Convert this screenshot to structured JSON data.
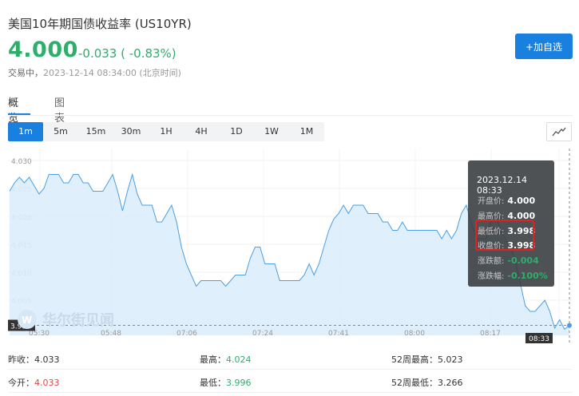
{
  "header": {
    "title": "美国10年期国债收益率 (US10YR)",
    "price": "4.000",
    "change": "-0.033 ( -0.83%)",
    "status_label": "交易中",
    "status_time": "2023-12-14 08:34:00 (北京时间)",
    "add_button": "+加自选"
  },
  "tabs": [
    {
      "label": "概览",
      "active": true
    },
    {
      "label": "图表",
      "active": false
    }
  ],
  "periods": [
    {
      "label": "1m",
      "active": true
    },
    {
      "label": "5m"
    },
    {
      "label": "15m"
    },
    {
      "label": "30m"
    },
    {
      "label": "1H"
    },
    {
      "label": "4H"
    },
    {
      "label": "1D"
    },
    {
      "label": "1W"
    },
    {
      "label": "1M"
    }
  ],
  "chart_data": {
    "type": "area",
    "y_ticks": [
      "4.030",
      "4.025",
      "4.020",
      "4.015",
      "4.010",
      "4.005",
      "4.000"
    ],
    "x_ticks": [
      "05:30",
      "05:48",
      "07:06",
      "07:24",
      "07:41",
      "08:00",
      "08:17",
      "08:33"
    ],
    "ylim": [
      3.999,
      4.031
    ],
    "current_label": "3.998",
    "time_label": "08:33",
    "values": [
      4.0245,
      4.026,
      4.027,
      4.026,
      4.027,
      4.0255,
      4.024,
      4.025,
      4.0275,
      4.0275,
      4.0275,
      4.026,
      4.026,
      4.0275,
      4.0275,
      4.026,
      4.026,
      4.0245,
      4.0245,
      4.0245,
      4.026,
      4.0275,
      4.0245,
      4.021,
      4.0245,
      4.0275,
      4.024,
      4.022,
      4.022,
      4.022,
      4.019,
      4.019,
      4.0205,
      4.022,
      4.019,
      4.0145,
      4.0115,
      4.0095,
      4.0075,
      4.0085,
      4.0085,
      4.0085,
      4.0085,
      4.0085,
      4.0075,
      4.0085,
      4.0095,
      4.0095,
      4.0095,
      4.0125,
      4.0145,
      4.0145,
      4.0115,
      4.0115,
      4.0115,
      4.0085,
      4.0085,
      4.0085,
      4.0085,
      4.0085,
      4.0095,
      4.0115,
      4.0095,
      4.0115,
      4.0145,
      4.0175,
      4.0195,
      4.0205,
      4.022,
      4.0205,
      4.022,
      4.022,
      4.022,
      4.0205,
      4.0205,
      4.0205,
      4.019,
      4.019,
      4.0175,
      4.0175,
      4.019,
      4.0175,
      4.0175,
      4.0175,
      4.0175,
      4.0175,
      4.0175,
      4.0175,
      4.016,
      4.0175,
      4.016,
      4.0175,
      4.0205,
      4.022,
      4.019,
      4.016,
      4.016,
      4.016,
      4.019,
      4.0205,
      4.0175,
      4.016,
      4.0145,
      4.012,
      4.008,
      4.004,
      4.003,
      4.003,
      4.004,
      4.005,
      4.003,
      4.0,
      4.0015,
      3.9998,
      4.0005
    ],
    "grid": true,
    "tooltip": {
      "time": "2023.12.14 08:33",
      "rows": [
        {
          "label": "开盘价:",
          "value": "4.000",
          "tone": "white"
        },
        {
          "label": "最高价:",
          "value": "4.000",
          "tone": "white"
        },
        {
          "label": "最低价:",
          "value": "3.998",
          "tone": "white"
        },
        {
          "label": "收盘价:",
          "value": "3.998",
          "tone": "white"
        },
        {
          "label": "涨跌额:",
          "value": "-0.004",
          "tone": "green"
        },
        {
          "label": "涨跌幅:",
          "value": "-0.100%",
          "tone": "green"
        }
      ]
    },
    "watermark": "华尔街见闻"
  },
  "stats": [
    {
      "label": "昨收：",
      "value": "4.033",
      "tone": "normal"
    },
    {
      "label": "最高：",
      "value": "4.024",
      "tone": "green"
    },
    {
      "label": "52周最高：",
      "value": "5.023",
      "tone": "normal"
    },
    {
      "label": "今开：",
      "value": "4.033",
      "tone": "red"
    },
    {
      "label": "最低：",
      "value": "3.996",
      "tone": "green"
    },
    {
      "label": "52周最低：",
      "value": "3.266",
      "tone": "normal"
    }
  ],
  "colors": {
    "accent": "#1a80e0",
    "up": "#e64545",
    "down": "#2dae6b",
    "line": "#4a9fe6",
    "area": "#dcedfb"
  }
}
